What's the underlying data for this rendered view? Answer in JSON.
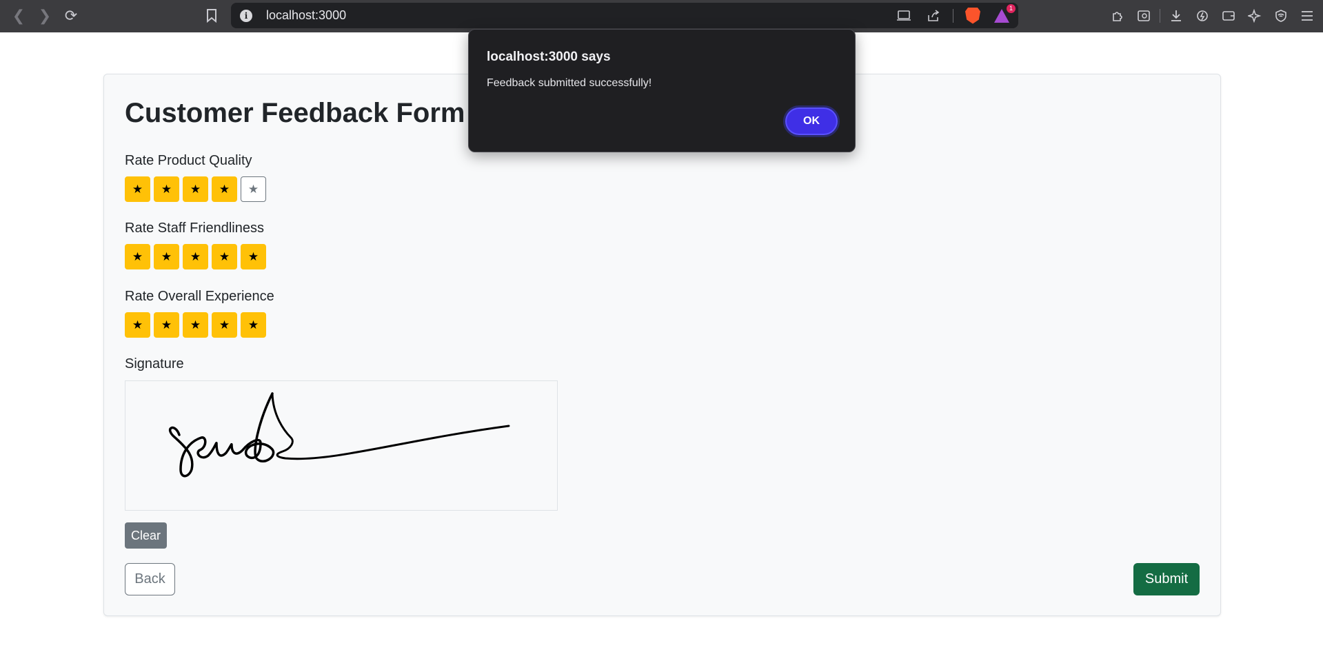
{
  "browser": {
    "url": "localhost:3000",
    "rewards_badge": "1"
  },
  "page": {
    "title": "Customer Feedback Form sl",
    "ratings": [
      {
        "label": "Rate Product Quality",
        "value": 4,
        "max": 5
      },
      {
        "label": "Rate Staff Friendliness",
        "value": 5,
        "max": 5
      },
      {
        "label": "Rate Overall Experience",
        "value": 5,
        "max": 5
      }
    ],
    "star_glyph": "★",
    "signature_label": "Signature",
    "clear_label": "Clear",
    "back_label": "Back",
    "submit_label": "Submit"
  },
  "dialog": {
    "title": "localhost:3000 says",
    "message": "Feedback submitted successfully!",
    "ok_label": "OK"
  },
  "colors": {
    "star_active": "#ffc107",
    "submit": "#146c43",
    "secondary": "#6c757d",
    "dialog_ok": "#3f2fe6"
  }
}
